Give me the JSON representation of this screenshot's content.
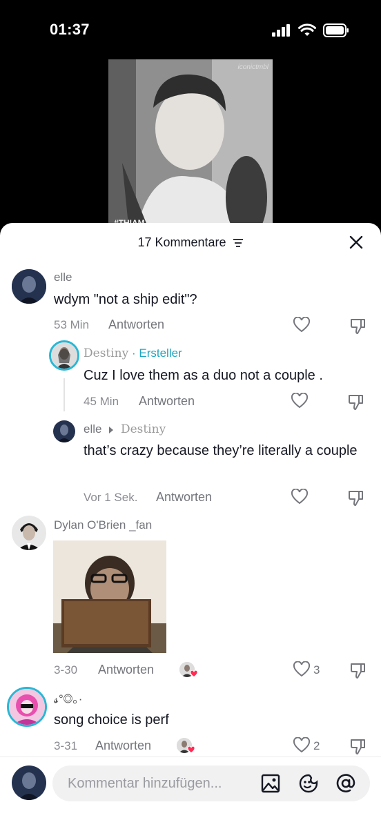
{
  "status": {
    "time": "01:37"
  },
  "video": {
    "hashtag": "#THIAM",
    "watermark": "iconictmbl"
  },
  "sheet": {
    "title": "17 Kommentare"
  },
  "comments": [
    {
      "user": "elle",
      "text": "wdym \"not a ship edit\"?",
      "time": "53 Min",
      "reply": "Antworten"
    },
    {
      "user": "Destiny",
      "badge": "· Ersteller",
      "text": "Cuz I love them as a duo not a couple .",
      "time": "45 Min",
      "reply": "Antworten"
    },
    {
      "user": "elle",
      "reply_to": "Destiny",
      "text": "that’s crazy because they’re literally a couple",
      "time": "Vor 1 Sek.",
      "reply": "Antworten"
    },
    {
      "user": "Dylan O'Brien _fan",
      "time": "3-30",
      "reply": "Antworten",
      "likes": "3"
    },
    {
      "user": "𝓼°◎。·",
      "text": "song choice is perf",
      "time": "3-31",
      "reply": "Antworten",
      "likes": "2"
    }
  ],
  "composer": {
    "placeholder": "Kommentar hinzufügen..."
  },
  "colors": {
    "creator": "#20a5c0",
    "like_heart": "#fe2c55"
  }
}
